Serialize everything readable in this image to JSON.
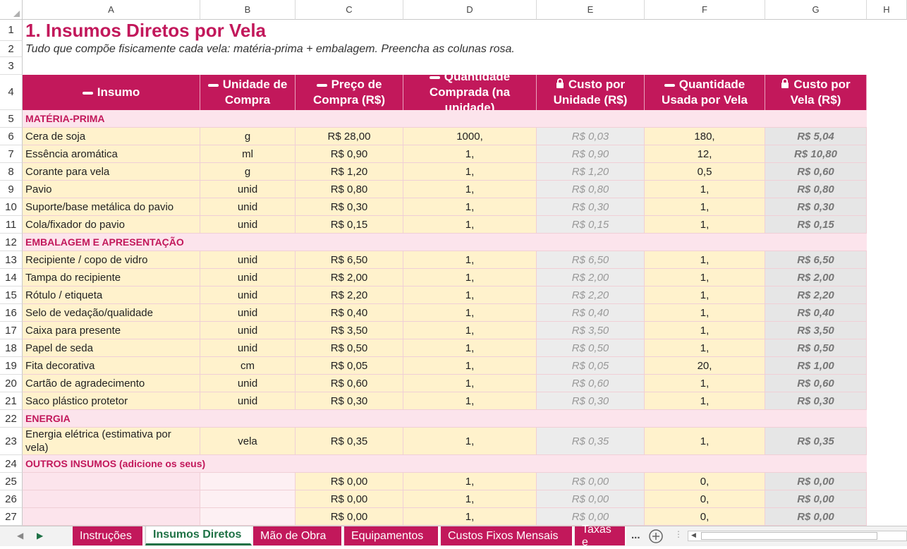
{
  "columns": [
    "A",
    "B",
    "C",
    "D",
    "E",
    "F",
    "G",
    "H"
  ],
  "row_numbers": [
    "1",
    "2",
    "3",
    "4",
    "5",
    "6",
    "7",
    "8",
    "9",
    "10",
    "11",
    "12",
    "13",
    "14",
    "15",
    "16",
    "17",
    "18",
    "19",
    "20",
    "21",
    "22",
    "23",
    "24",
    "25",
    "26",
    "27"
  ],
  "title": "1. Insumos Diretos por Vela",
  "subtitle": "Tudo que compõe fisicamente cada vela: matéria-prima + embalagem. Preencha as colunas rosa.",
  "headers": [
    {
      "icon": "pencil-icon",
      "text": "Insumo"
    },
    {
      "icon": "pencil-icon",
      "text": "Unidade de Compra"
    },
    {
      "icon": "pencil-icon",
      "text": "Preço de Compra (R$)"
    },
    {
      "icon": "pencil-icon",
      "text": "Quantidade Comprada (na unidade)"
    },
    {
      "icon": "lock-icon",
      "text": "Custo por Unidade (R$)"
    },
    {
      "icon": "pencil-icon",
      "text": "Quantidade Usada por Vela"
    },
    {
      "icon": "lock-icon",
      "text": "Custo por Vela (R$)"
    }
  ],
  "rows": [
    {
      "type": "section",
      "label": "MATÉRIA-PRIMA"
    },
    {
      "type": "item",
      "insumo": "Cera de soja",
      "unidade": "g",
      "preco": "R$ 28,00",
      "qtd_comprada": "1000,",
      "custo_unidade": "R$ 0,03",
      "qtd_usada": "180,",
      "custo_vela": "R$ 5,04"
    },
    {
      "type": "item",
      "insumo": "Essência aromática",
      "unidade": "ml",
      "preco": "R$ 0,90",
      "qtd_comprada": "1,",
      "custo_unidade": "R$ 0,90",
      "qtd_usada": "12,",
      "custo_vela": "R$ 10,80"
    },
    {
      "type": "item",
      "insumo": "Corante para vela",
      "unidade": "g",
      "preco": "R$ 1,20",
      "qtd_comprada": "1,",
      "custo_unidade": "R$ 1,20",
      "qtd_usada": "0,5",
      "custo_vela": "R$ 0,60"
    },
    {
      "type": "item",
      "insumo": "Pavio",
      "unidade": "unid",
      "preco": "R$ 0,80",
      "qtd_comprada": "1,",
      "custo_unidade": "R$ 0,80",
      "qtd_usada": "1,",
      "custo_vela": "R$ 0,80"
    },
    {
      "type": "item",
      "insumo": "Suporte/base metálica do pavio",
      "unidade": "unid",
      "preco": "R$ 0,30",
      "qtd_comprada": "1,",
      "custo_unidade": "R$ 0,30",
      "qtd_usada": "1,",
      "custo_vela": "R$ 0,30"
    },
    {
      "type": "item",
      "insumo": "Cola/fixador do pavio",
      "unidade": "unid",
      "preco": "R$ 0,15",
      "qtd_comprada": "1,",
      "custo_unidade": "R$ 0,15",
      "qtd_usada": "1,",
      "custo_vela": "R$ 0,15"
    },
    {
      "type": "section",
      "label": "EMBALAGEM E APRESENTAÇÃO"
    },
    {
      "type": "item",
      "insumo": "Recipiente / copo de vidro",
      "unidade": "unid",
      "preco": "R$ 6,50",
      "qtd_comprada": "1,",
      "custo_unidade": "R$ 6,50",
      "qtd_usada": "1,",
      "custo_vela": "R$ 6,50"
    },
    {
      "type": "item",
      "insumo": "Tampa do recipiente",
      "unidade": "unid",
      "preco": "R$ 2,00",
      "qtd_comprada": "1,",
      "custo_unidade": "R$ 2,00",
      "qtd_usada": "1,",
      "custo_vela": "R$ 2,00"
    },
    {
      "type": "item",
      "insumo": "Rótulo / etiqueta",
      "unidade": "unid",
      "preco": "R$ 2,20",
      "qtd_comprada": "1,",
      "custo_unidade": "R$ 2,20",
      "qtd_usada": "1,",
      "custo_vela": "R$ 2,20"
    },
    {
      "type": "item",
      "insumo": "Selo de vedação/qualidade",
      "unidade": "unid",
      "preco": "R$ 0,40",
      "qtd_comprada": "1,",
      "custo_unidade": "R$ 0,40",
      "qtd_usada": "1,",
      "custo_vela": "R$ 0,40"
    },
    {
      "type": "item",
      "insumo": "Caixa para presente",
      "unidade": "unid",
      "preco": "R$ 3,50",
      "qtd_comprada": "1,",
      "custo_unidade": "R$ 3,50",
      "qtd_usada": "1,",
      "custo_vela": "R$ 3,50"
    },
    {
      "type": "item",
      "insumo": "Papel de seda",
      "unidade": "unid",
      "preco": "R$ 0,50",
      "qtd_comprada": "1,",
      "custo_unidade": "R$ 0,50",
      "qtd_usada": "1,",
      "custo_vela": "R$ 0,50"
    },
    {
      "type": "item",
      "insumo": "Fita decorativa",
      "unidade": "cm",
      "preco": "R$ 0,05",
      "qtd_comprada": "1,",
      "custo_unidade": "R$ 0,05",
      "qtd_usada": "20,",
      "custo_vela": "R$ 1,00"
    },
    {
      "type": "item",
      "insumo": "Cartão de agradecimento",
      "unidade": "unid",
      "preco": "R$ 0,60",
      "qtd_comprada": "1,",
      "custo_unidade": "R$ 0,60",
      "qtd_usada": "1,",
      "custo_vela": "R$ 0,60"
    },
    {
      "type": "item",
      "insumo": "Saco plástico protetor",
      "unidade": "unid",
      "preco": "R$ 0,30",
      "qtd_comprada": "1,",
      "custo_unidade": "R$ 0,30",
      "qtd_usada": "1,",
      "custo_vela": "R$ 0,30"
    },
    {
      "type": "section",
      "label": "ENERGIA"
    },
    {
      "type": "item",
      "insumo": "Energia elétrica (estimativa por vela)",
      "unidade": "vela",
      "preco": "R$ 0,35",
      "qtd_comprada": "1,",
      "custo_unidade": "R$ 0,35",
      "qtd_usada": "1,",
      "custo_vela": "R$ 0,35"
    },
    {
      "type": "section",
      "label": "OUTROS INSUMOS (adicione os seus)"
    },
    {
      "type": "blank",
      "insumo": "",
      "unidade": "",
      "preco": "R$ 0,00",
      "qtd_comprada": "1,",
      "custo_unidade": "R$ 0,00",
      "qtd_usada": "0,",
      "custo_vela": "R$ 0,00"
    },
    {
      "type": "blank",
      "insumo": "",
      "unidade": "",
      "preco": "R$ 0,00",
      "qtd_comprada": "1,",
      "custo_unidade": "R$ 0,00",
      "qtd_usada": "0,",
      "custo_vela": "R$ 0,00"
    },
    {
      "type": "blank",
      "insumo": "",
      "unidade": "",
      "preco": "R$ 0,00",
      "qtd_comprada": "1,",
      "custo_unidade": "R$ 0,00",
      "qtd_usada": "0,",
      "custo_vela": "R$ 0,00"
    }
  ],
  "tabs": [
    {
      "label": "Instruções",
      "active": false
    },
    {
      "label": "Insumos Diretos",
      "active": true
    },
    {
      "label": "Mão de Obra",
      "active": false
    },
    {
      "label": "Equipamentos",
      "active": false
    },
    {
      "label": "Custos Fixos Mensais",
      "active": false
    },
    {
      "label": "Taxas e",
      "active": false
    }
  ],
  "tab_overflow": "...",
  "colors": {
    "accent": "#c2185b",
    "input_fill": "#fff2cc",
    "section_fill": "#fce4ec",
    "calc_fill": "#ececec",
    "active_tab": "#1e7145"
  }
}
